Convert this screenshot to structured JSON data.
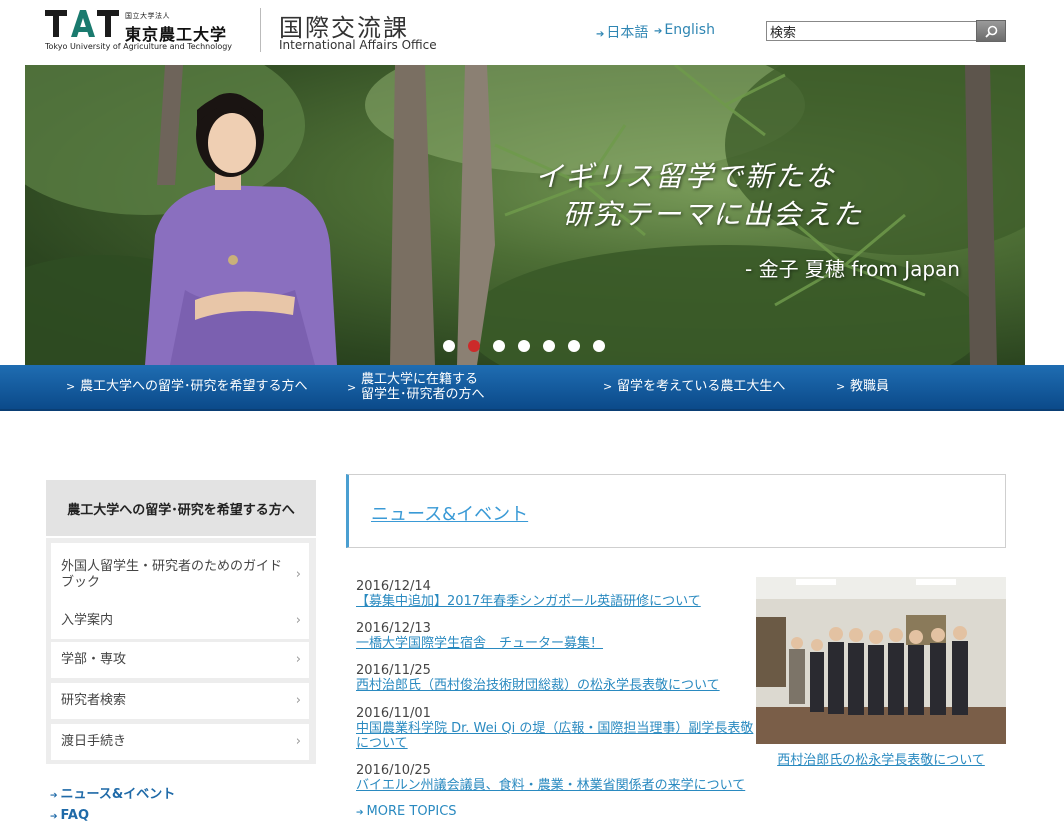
{
  "header": {
    "logo": {
      "mark": "TAT",
      "small_label": "国立大学法人",
      "name_ja": "東京農工大学",
      "name_en": "Tokyo University of Agriculture and Technology"
    },
    "office_ja": "国際交流課",
    "office_en": "International Affairs Office",
    "lang_links": [
      "日本語",
      "English"
    ],
    "search": {
      "value": "検索",
      "icon": "magnifier-icon"
    }
  },
  "hero": {
    "quote_line1": "イギリス留学で新たな",
    "quote_line2": "研究テーマに出会えた",
    "attribution": "- 金子 夏穂  from Japan",
    "slides_total": 7,
    "active_slide": 2
  },
  "nav": {
    "items": [
      {
        "label": "農工大学への留学･研究を希望する方へ"
      },
      {
        "label_line1": "農工大学に在籍する",
        "label_line2": "留学生･研究者の方へ"
      },
      {
        "label": "留学を考えている農工大生へ"
      },
      {
        "label": "教職員"
      }
    ]
  },
  "sidebar": {
    "heading": "農工大学への留学･研究を希望する方へ",
    "items": [
      "外国人留学生・研究者のためのガイドブック",
      "入学案内",
      "学部・専攻",
      "研究者検索",
      "渡日手続き"
    ],
    "links": [
      "ニュース&イベント",
      "FAQ"
    ]
  },
  "main": {
    "section_title": "ニュース&イベント",
    "news": [
      {
        "date": "2016/12/14",
        "title": "【募集中追加】2017年春季シンガポール英語研修について"
      },
      {
        "date": "2016/12/13",
        "title": "一橋大学国際学生宿舎　チューター募集！"
      },
      {
        "date": "2016/11/25",
        "title": "西村治郎氏（西村俊治技術財団総裁）の松永学長表敬について"
      },
      {
        "date": "2016/11/01",
        "title": "中国農業科学院 Dr. Wei Qi の堤（広報・国際担当理事）副学長表敬について"
      },
      {
        "date": "2016/10/25",
        "title": "バイエルン州議会議員、食料・農業・林業省関係者の来学について"
      }
    ],
    "more_label": "MORE TOPICS",
    "feature_caption": "西村治郎氏の松永学長表敬について"
  },
  "colors": {
    "nav_blue": "#0b4a8a",
    "link_blue": "#2a8ac0",
    "active_dot": "#cc2a2a",
    "logo_teal": "#1a7a6e"
  }
}
